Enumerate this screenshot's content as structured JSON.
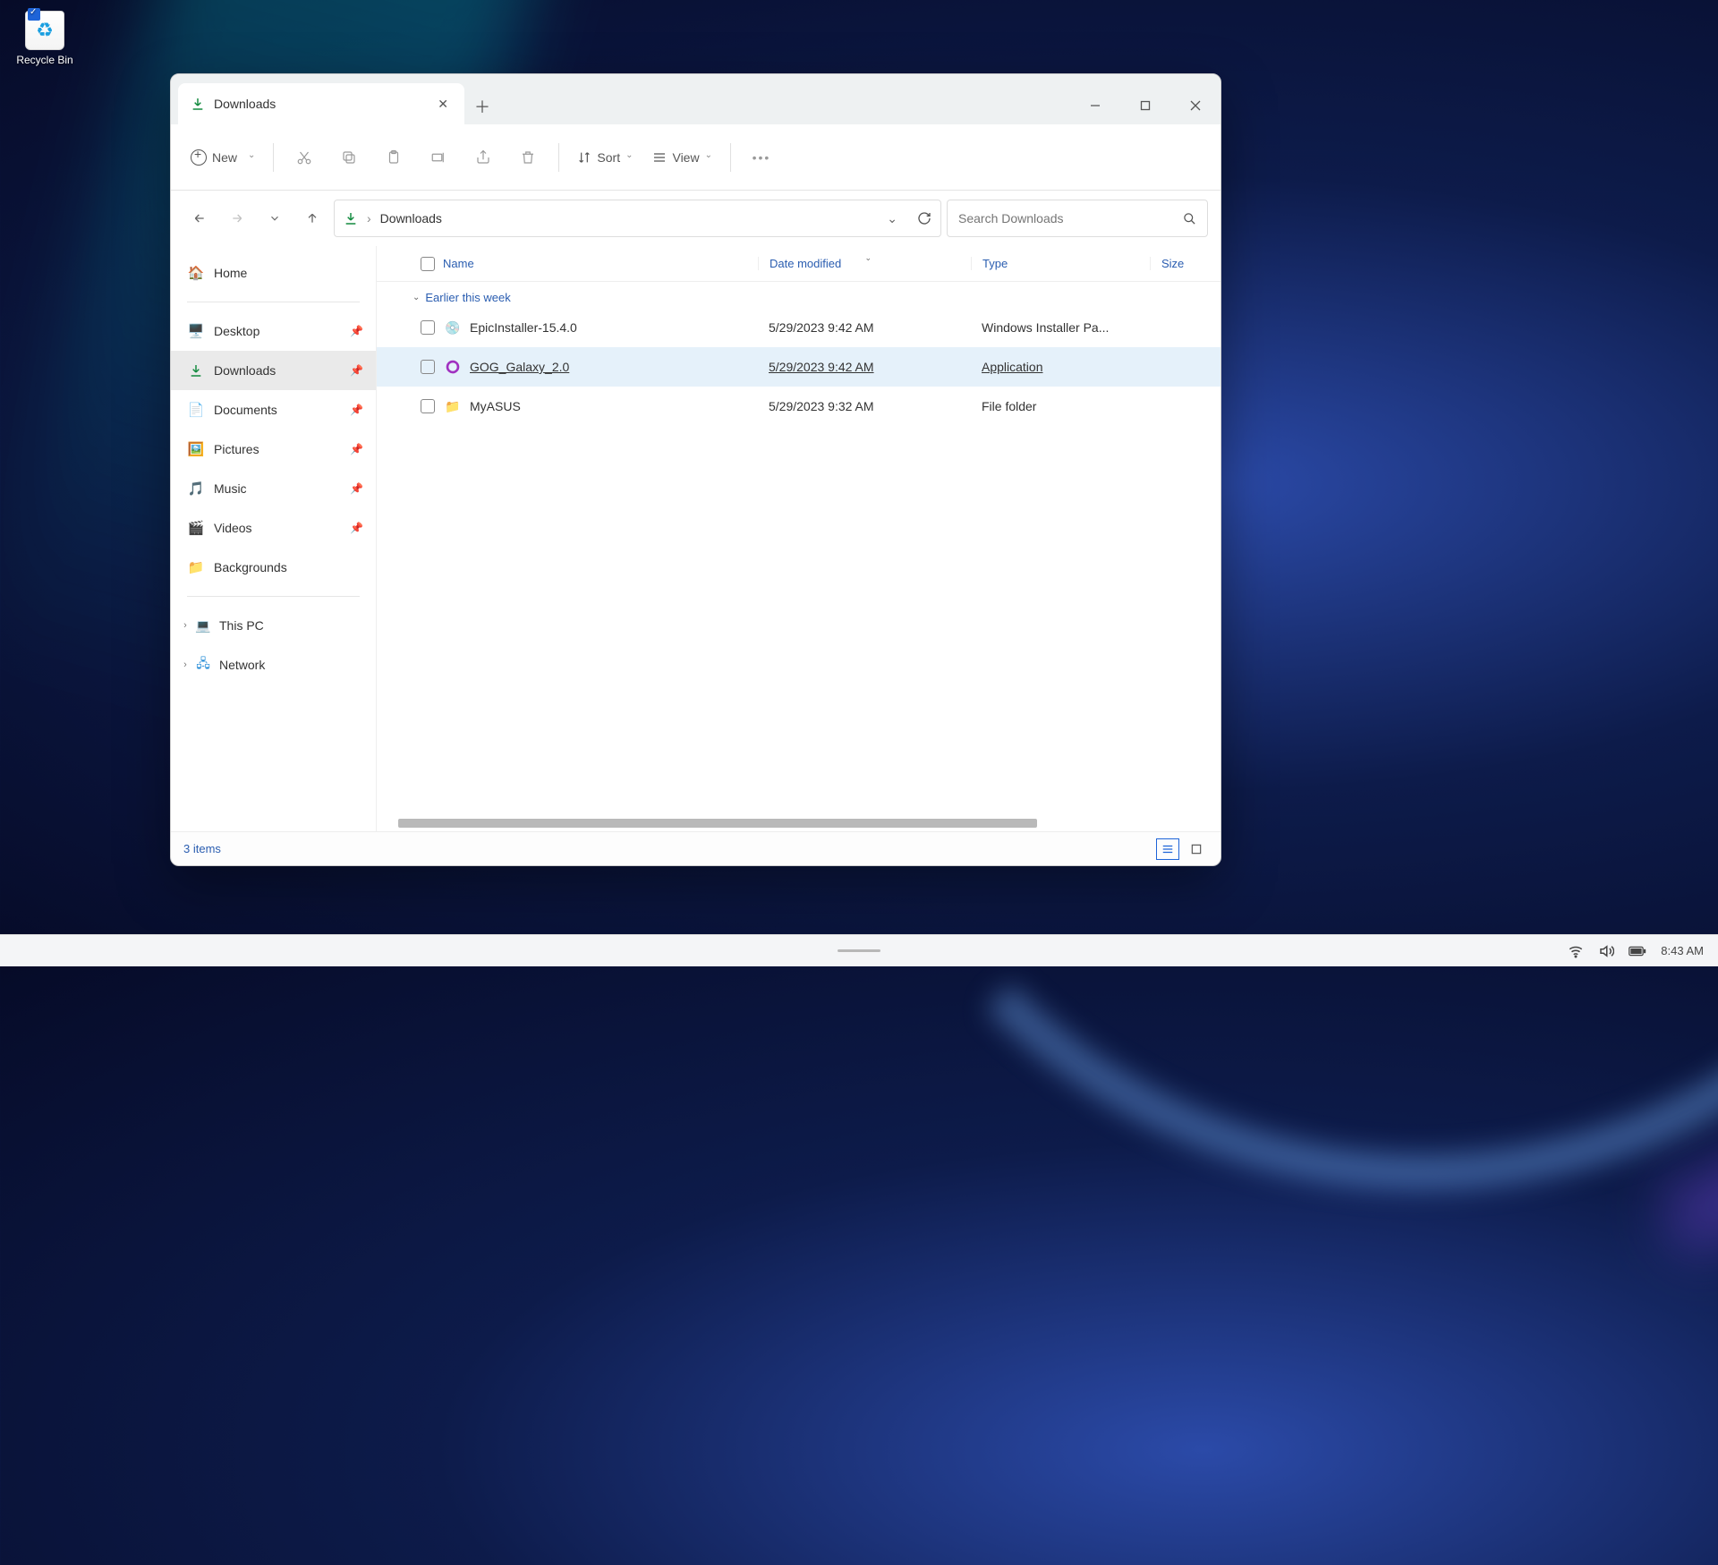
{
  "desktop": {
    "recycle_bin": "Recycle Bin"
  },
  "window": {
    "tab_title": "Downloads",
    "toolbar": {
      "new": "New",
      "sort": "Sort",
      "view": "View"
    },
    "breadcrumb": {
      "location": "Downloads"
    },
    "search": {
      "placeholder": "Search Downloads"
    },
    "columns": {
      "name": "Name",
      "date": "Date modified",
      "type": "Type",
      "size": "Size"
    },
    "group_label": "Earlier this week",
    "files": [
      {
        "name": "EpicInstaller-15.4.0",
        "date": "5/29/2023 9:42 AM",
        "type": "Windows Installer Pa...",
        "icon": "msi"
      },
      {
        "name": "GOG_Galaxy_2.0",
        "date": "5/29/2023 9:42 AM",
        "type": "Application",
        "icon": "gog",
        "selected": true
      },
      {
        "name": "MyASUS",
        "date": "5/29/2023 9:32 AM",
        "type": "File folder",
        "icon": "folder"
      }
    ],
    "status": "3 items"
  },
  "sidebar": {
    "home": "Home",
    "items": [
      {
        "label": "Desktop",
        "icon": "desktop",
        "pinned": true
      },
      {
        "label": "Downloads",
        "icon": "downloads",
        "pinned": true,
        "active": true
      },
      {
        "label": "Documents",
        "icon": "docs",
        "pinned": true
      },
      {
        "label": "Pictures",
        "icon": "pics",
        "pinned": true
      },
      {
        "label": "Music",
        "icon": "music",
        "pinned": true
      },
      {
        "label": "Videos",
        "icon": "videos",
        "pinned": true
      },
      {
        "label": "Backgrounds",
        "icon": "folder",
        "pinned": false
      }
    ],
    "tree": [
      {
        "label": "This PC",
        "icon": "pc"
      },
      {
        "label": "Network",
        "icon": "net"
      }
    ]
  },
  "taskbar": {
    "clock": "8:43 AM"
  }
}
